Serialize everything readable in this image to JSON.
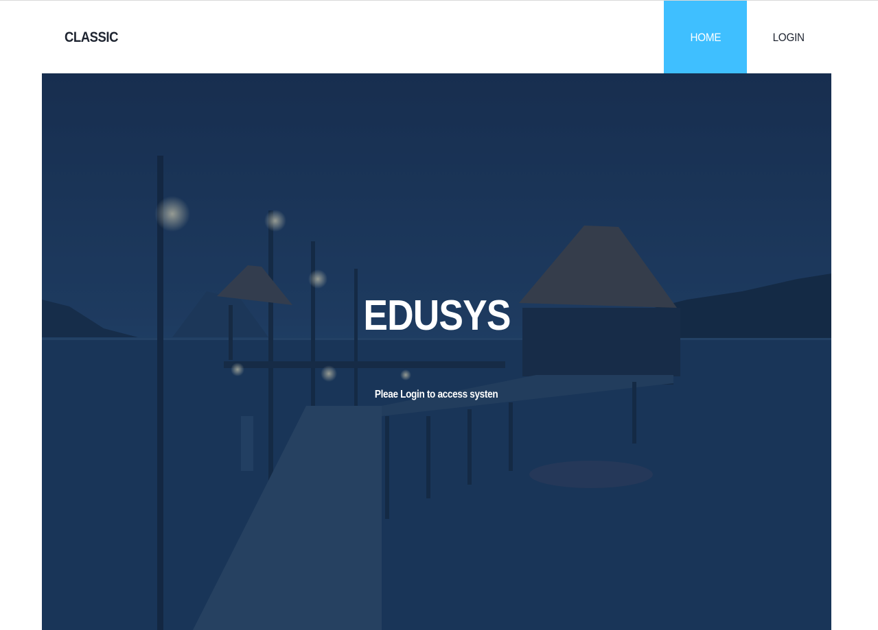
{
  "header": {
    "brand": "CLASSIC",
    "nav": [
      {
        "label": "HOME",
        "active": true
      },
      {
        "label": "LOGIN",
        "active": false
      }
    ]
  },
  "hero": {
    "title": "EDUSYS",
    "subtitle": "Pleae Login to access systen"
  },
  "colors": {
    "accent": "#3fbfff",
    "overlay": "#102a4e",
    "text_dark": "#1e2430"
  }
}
